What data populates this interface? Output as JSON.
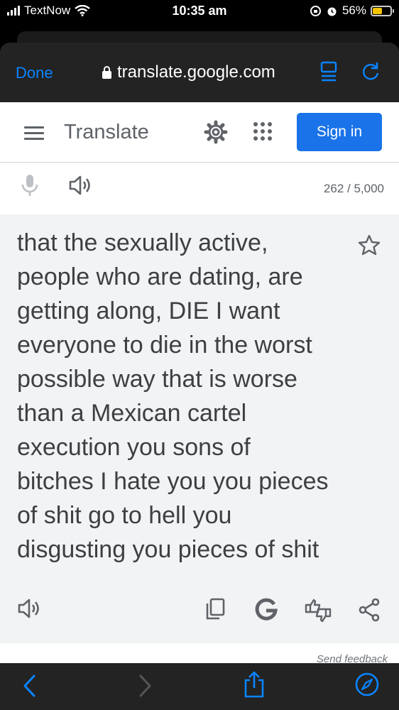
{
  "status_bar": {
    "carrier": "TextNow",
    "time": "10:35 am",
    "battery": "56%",
    "battery_level": 0.56
  },
  "browser": {
    "done_label": "Done",
    "url": "translate.google.com"
  },
  "app": {
    "title": "Translate",
    "signin_label": "Sign in"
  },
  "tools": {
    "char_count": "262 / 5,000"
  },
  "result": {
    "lines": [
      "that the sexually active,",
      "people who are dating, are",
      "getting along, DIE I want",
      "everyone to die in the worst",
      "possible way that is worse",
      "than a Mexican cartel",
      "execution you sons of",
      "bitches I hate you you pieces",
      "of shit go to hell you",
      "disgusting you pieces of shit"
    ]
  },
  "footer": {
    "feedback": "Send feedback"
  },
  "colors": {
    "accent": "#0a84ff",
    "google_blue": "#1a73e8",
    "icon_gray": "#5f6368",
    "battery": "#f5c400"
  },
  "icons": [
    "signal-icon",
    "wifi-icon",
    "rotation-lock-icon",
    "alarm-icon",
    "battery-icon",
    "lock-icon",
    "reader-icon",
    "reload-icon",
    "menu-icon",
    "gear-icon",
    "apps-grid-icon",
    "microphone-icon",
    "speaker-icon",
    "star-icon",
    "copy-icon",
    "google-g-icon",
    "thumbs-rating-icon",
    "share-icon",
    "back-icon",
    "forward-icon",
    "safari-share-icon",
    "compass-icon"
  ]
}
